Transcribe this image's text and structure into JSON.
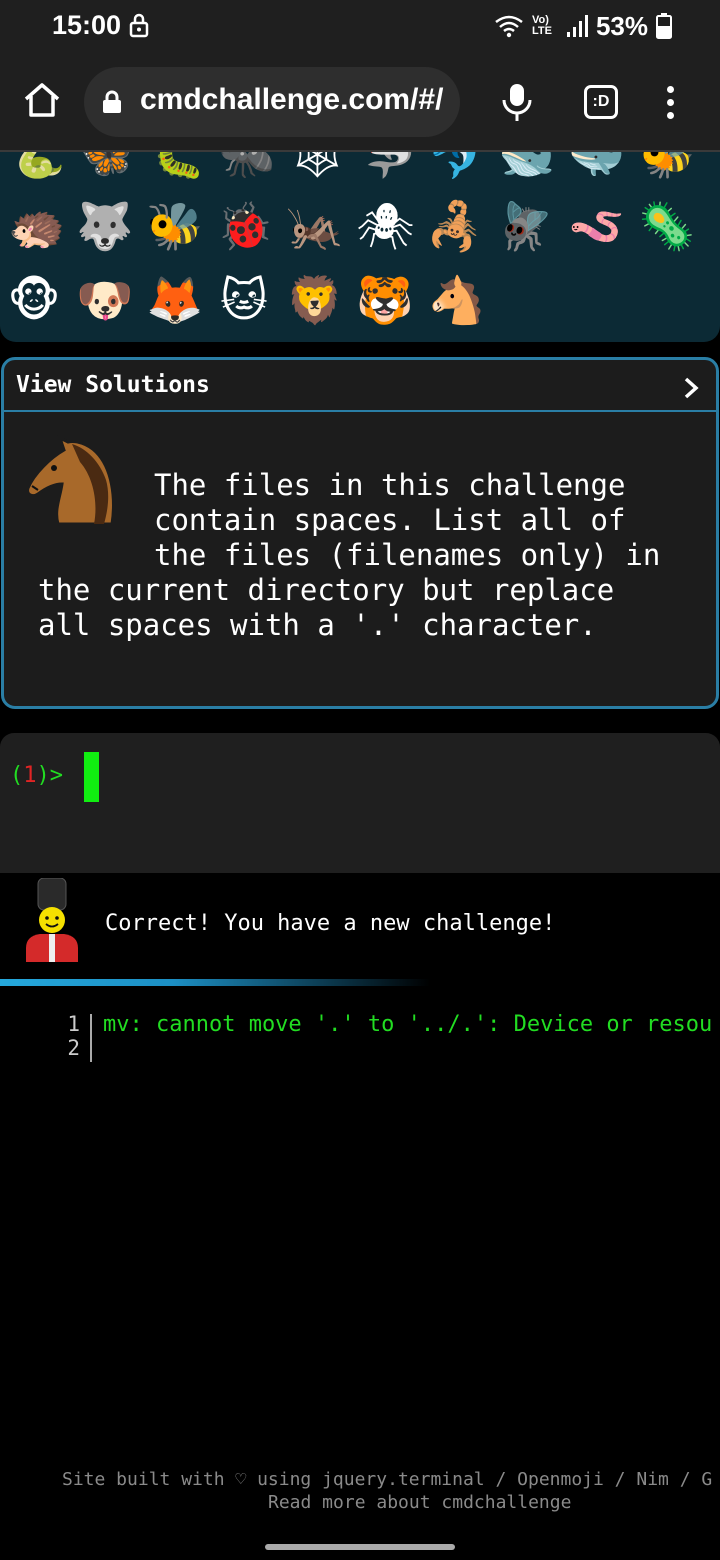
{
  "status_bar": {
    "time": "15:00",
    "network": "Vo) LTE",
    "battery": "53%",
    "icons": [
      "lock-icon",
      "wifi-icon",
      "signal-icon",
      "battery-icon"
    ]
  },
  "browser": {
    "url": "cmdchallenge.com/#/",
    "tabs_label": ":D",
    "icons": [
      "home-icon",
      "lock-icon",
      "mic-icon",
      "tabs-icon",
      "menu-icon"
    ]
  },
  "emoji_grid": {
    "row_partial": [
      "🐍",
      "🦋",
      "🐛",
      "🐜",
      "🕸",
      "🦈",
      "🐬",
      "🐋",
      "🐳",
      "🐝"
    ],
    "row1": [
      "🦔",
      "🐺",
      "🐝",
      "🐞",
      "🦗",
      "🕷",
      "🦂",
      "🪰",
      "🪱",
      "🦠"
    ],
    "row2": [
      "🐵",
      "🐶",
      "🦊",
      "🐱",
      "🦁",
      "🐯",
      "🐴"
    ]
  },
  "solutions": {
    "title": "View Solutions",
    "description": "The files in this challenge\ncontain spaces. List all of\nthe files (filenames only) in\nthe current directory but replace\nall spaces with a '.' character.",
    "line1": "The files in this challenge",
    "line2": "contain spaces. List all of",
    "line3": "the files (filenames only) in",
    "line4": "the current directory but replace",
    "line5": "all spaces with a '.' character."
  },
  "terminal": {
    "prompt_open": "(",
    "prompt_num": "1",
    "prompt_close": ")>"
  },
  "message": {
    "text": "Correct! You have a new challenge!"
  },
  "output": {
    "line_numbers": [
      "1",
      "2"
    ],
    "line1": "mv: cannot move '.' to '../.': Device or resou"
  },
  "footer": {
    "line1": "Site built with ♡ using jquery.terminal / Openmoji / Nim / G",
    "line2": "Read more about cmdchallenge"
  },
  "colors": {
    "accent": "#2a7ea5",
    "prompt_green": "#22dd22",
    "prompt_red": "#e02424",
    "panel_bg": "#0c2a35"
  }
}
